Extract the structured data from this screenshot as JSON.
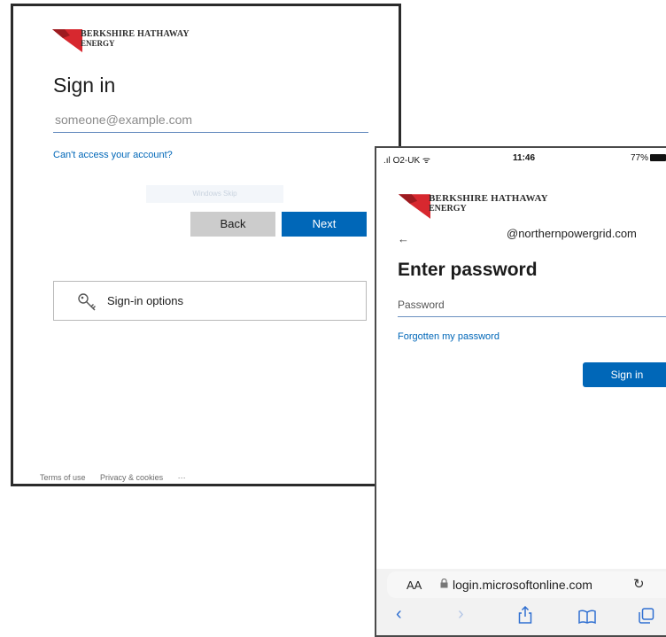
{
  "desktop": {
    "brand_line1": "BERKSHIRE HATHAWAY",
    "brand_line2": "ENERGY",
    "title": "Sign in",
    "email_placeholder": "someone@example.com",
    "cant_access": "Can't access your account?",
    "faded_label": "Windows Skip",
    "back_label": "Back",
    "next_label": "Next",
    "sign_in_options": "Sign-in options",
    "footer": {
      "terms": "Terms of use",
      "privacy": "Privacy & cookies",
      "more": "···"
    }
  },
  "phone": {
    "status": {
      "carrier": "O2-UK",
      "time": "11:46",
      "battery": "77%"
    },
    "brand_line1": "BERKSHIRE HATHAWAY",
    "brand_line2": "ENERGY",
    "back_arrow": "←",
    "email_domain": "@northernpowergrid.com",
    "title": "Enter password",
    "password_placeholder": "Password",
    "forgot": "Forgotten my password",
    "sign_in_label": "Sign in",
    "browser": {
      "text_size": "AA",
      "url": "login.microsoftonline.com",
      "icons": {
        "lock": "lock-icon",
        "reload": "reload-icon",
        "back": "back-arrow-icon",
        "forward": "forward-arrow-icon",
        "share": "share-icon",
        "bookmarks": "bookmarks-icon",
        "tabs": "tabs-icon"
      }
    }
  },
  "colors": {
    "brand_red": "#d7282f",
    "accent_blue": "#0067b8",
    "back_button": "#cccccc"
  }
}
